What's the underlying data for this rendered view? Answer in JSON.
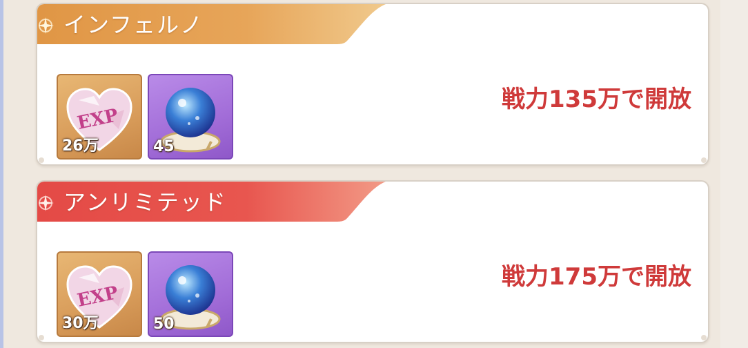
{
  "colors": {
    "inferno_banner": "#e7a559",
    "unlimited_banner": "#e8564f",
    "unlock_text": "#cf3a3a",
    "exp_tile": "#d89c5a",
    "orb_tile": "#a26dd8"
  },
  "modes": [
    {
      "title": "インフェルノ",
      "unlock": "戦力135万で開放",
      "rewards": [
        {
          "icon": "exp-heart-icon",
          "quantity": "26万"
        },
        {
          "icon": "crystal-orb-icon",
          "quantity": "45"
        }
      ]
    },
    {
      "title": "アンリミテッド",
      "unlock": "戦力175万で開放",
      "rewards": [
        {
          "icon": "exp-heart-icon",
          "quantity": "30万"
        },
        {
          "icon": "crystal-orb-icon",
          "quantity": "50"
        }
      ]
    }
  ]
}
